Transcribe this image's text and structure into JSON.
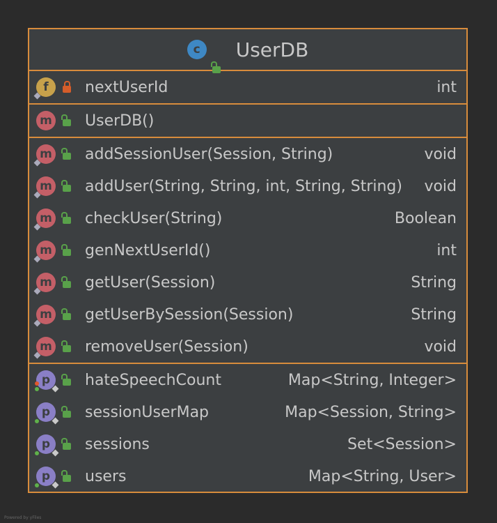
{
  "class": {
    "name": "UserDB",
    "badge": "c"
  },
  "fields": [
    {
      "badge": "f",
      "name": "nextUserId",
      "type": "int"
    }
  ],
  "constructors": [
    {
      "badge": "m",
      "name": "UserDB()",
      "type": ""
    }
  ],
  "methods": [
    {
      "badge": "m",
      "name": "addSessionUser(Session, String)",
      "type": "void"
    },
    {
      "badge": "m",
      "name": "addUser(String, String, int, String, String)",
      "type": "void"
    },
    {
      "badge": "m",
      "name": "checkUser(String)",
      "type": "Boolean"
    },
    {
      "badge": "m",
      "name": "genNextUserId()",
      "type": "int"
    },
    {
      "badge": "m",
      "name": "getUser(Session)",
      "type": "String"
    },
    {
      "badge": "m",
      "name": "getUserBySession(Session)",
      "type": "String"
    },
    {
      "badge": "m",
      "name": "removeUser(Session)",
      "type": "void"
    }
  ],
  "properties": [
    {
      "badge": "p",
      "name": "hateSpeechCount",
      "type": "Map<String, Integer>"
    },
    {
      "badge": "p",
      "name": "sessionUserMap",
      "type": "Map<Session, String>"
    },
    {
      "badge": "p",
      "name": "sessions",
      "type": "Set<Session>"
    },
    {
      "badge": "p",
      "name": "users",
      "type": "Map<String, User>"
    }
  ],
  "footer": {
    "watermark": "Powered by yFiles"
  },
  "colors": {
    "border": "#d88c3c",
    "background": "#3c3f41",
    "text": "#c8c8c8"
  }
}
